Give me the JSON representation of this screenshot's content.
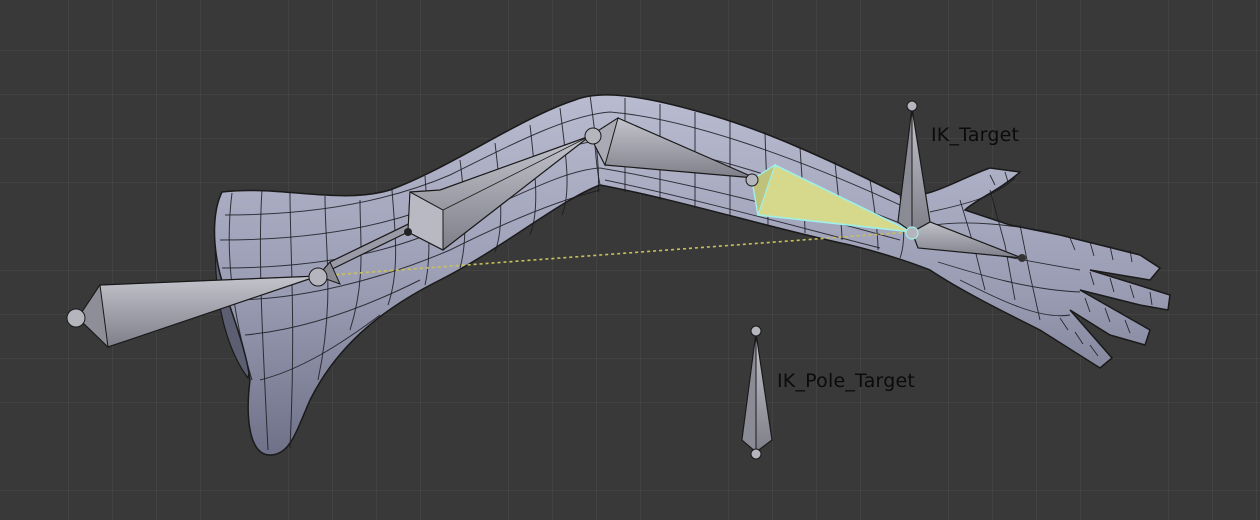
{
  "viewport": {
    "background_color": "#393939",
    "grid_line_color": "#444444",
    "mesh_color": "#9fa1b8",
    "mesh_shadow_color": "#6c6e86",
    "mesh_wire_color": "#1a1a1a",
    "bone_color": "#a8a9b3",
    "bone_shade_color": "#7d7e88",
    "active_bone_color": "#d6d98c",
    "active_bone_outline": "#9ef0e8",
    "ik_line_color": "#c9c25a"
  },
  "labels": {
    "ik_target": "IK_Target",
    "ik_pole_target": "IK_Pole_Target"
  },
  "objects": [
    "arm-mesh",
    "upper-arm-bone",
    "forearm-bone",
    "hand-bone",
    "ik-target-bone",
    "ik-pole-target-bone",
    "ik-chain-line"
  ]
}
